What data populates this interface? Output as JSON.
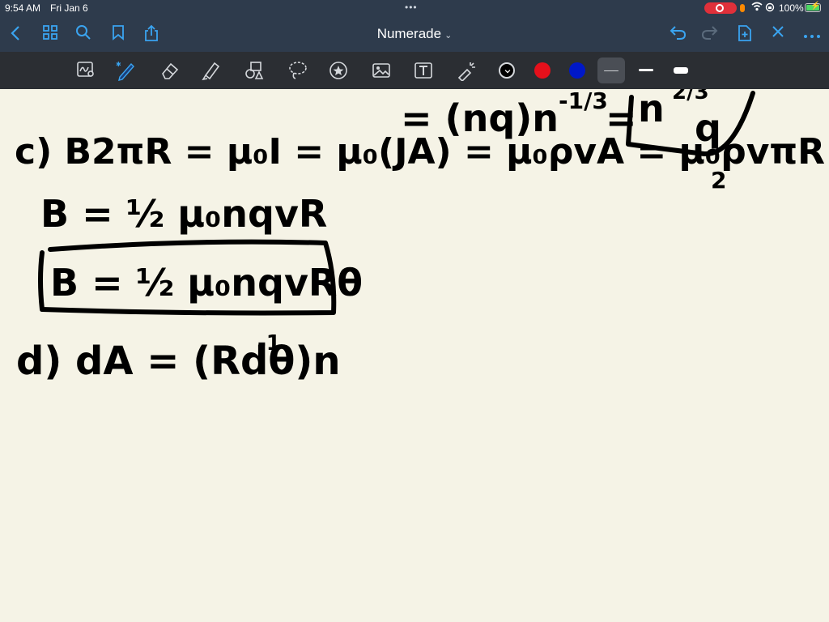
{
  "status": {
    "time": "9:54 AM",
    "date": "Fri Jan 6",
    "battery": "100%"
  },
  "nav": {
    "title": "Numerade",
    "icons": [
      "chevron-left-icon",
      "grid-icon",
      "search-icon",
      "bookmark-icon",
      "share-icon",
      "undo-icon",
      "redo-icon",
      "add-page-icon",
      "close-icon",
      "more-icon"
    ]
  },
  "toolbar": {
    "tools": [
      "handwriting-zoom-icon",
      "pen-icon",
      "eraser-icon",
      "highlighter-icon",
      "shapes-icon",
      "lasso-icon",
      "sticker-icon",
      "image-icon",
      "text-icon",
      "laser-pointer-icon"
    ],
    "colors": {
      "black": "#000000",
      "red": "#e5101b",
      "blue": "#0018c8"
    }
  },
  "handwritten": {
    "line0": "= (nq)n",
    "line0_exp": "-1/3",
    "line0_eq": "=",
    "boxed_top": "n",
    "boxed_top_exp": "2/3",
    "boxed_top_q": "q",
    "line_c": "c) B2πR = μ₀I = μ₀(JA) = μ₀ρvA = μ₀ρvπR",
    "line_c_exp": "2",
    "line_b1": "B = ½ μ₀nqvR",
    "line_b2": "B = ½ μ₀nqvRθ",
    "line_d": "d) dA = (Rdθ)n",
    "line_d_exp": "-1"
  }
}
